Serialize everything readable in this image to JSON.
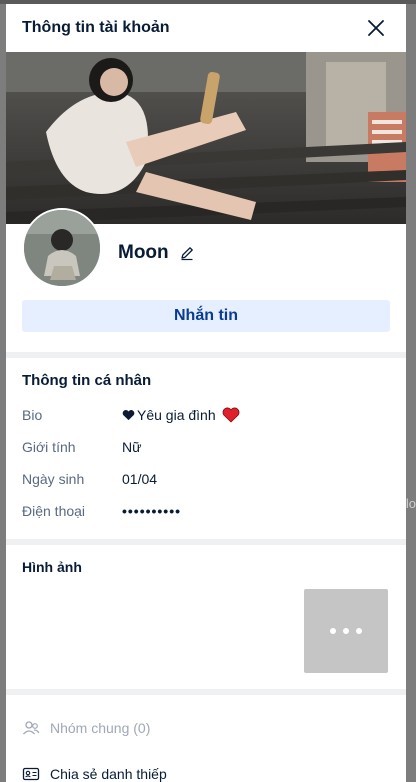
{
  "modal": {
    "title": "Thông tin tài khoản"
  },
  "profile": {
    "name": "Moon",
    "message_button": "Nhắn tin"
  },
  "personal_info": {
    "title": "Thông tin cá nhân",
    "rows": [
      {
        "label": "Bio",
        "value": "Yêu gia đình"
      },
      {
        "label": "Giới tính",
        "value": "Nữ"
      },
      {
        "label": "Ngày sinh",
        "value": "01/04"
      },
      {
        "label": "Điện thoại",
        "value": "••••••••••"
      }
    ],
    "bio_icons": [
      "black-heart-icon",
      "red-heart-icon"
    ]
  },
  "images": {
    "title": "Hình ảnh",
    "more_icon": "more-dots-icon"
  },
  "actions": {
    "common_groups": "Nhóm chung (0)",
    "share_card": "Chia sẻ danh thiếp"
  },
  "backdrop": {
    "edge_text": "lo"
  },
  "colors": {
    "accent": "#0a3d8f",
    "message_bg": "#e5efff",
    "heart_red": "#e0202a"
  }
}
